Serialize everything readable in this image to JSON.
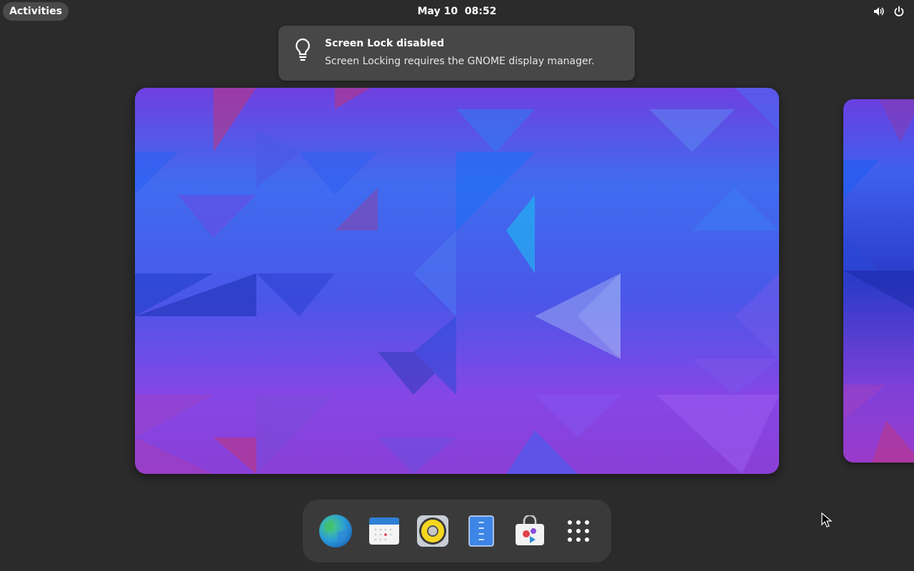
{
  "topbar": {
    "activities_label": "Activities",
    "clock": "May 10  08:52",
    "volume_icon": "volume-high-icon",
    "power_icon": "power-icon"
  },
  "notification": {
    "icon": "lightbulb-icon",
    "title": "Screen Lock disabled",
    "body": "Screen Locking requires the GNOME display manager."
  },
  "workspaces": [
    {
      "name": "workspace-1",
      "active": true
    },
    {
      "name": "workspace-2",
      "active": false
    }
  ],
  "dock": {
    "items": [
      {
        "icon": "web-browser-icon"
      },
      {
        "icon": "calendar-icon"
      },
      {
        "icon": "rhythmbox-speaker-icon"
      },
      {
        "icon": "text-editor-icon"
      },
      {
        "icon": "software-store-icon"
      },
      {
        "icon": "show-apps-grid-icon"
      }
    ]
  },
  "colors": {
    "panel_bg": "#2b2b2b",
    "notification_bg": "#474747",
    "dock_bg": "#3a3a3a",
    "wallpaper_blue": "#3b6cf0",
    "wallpaper_purple": "#8a47e8"
  }
}
